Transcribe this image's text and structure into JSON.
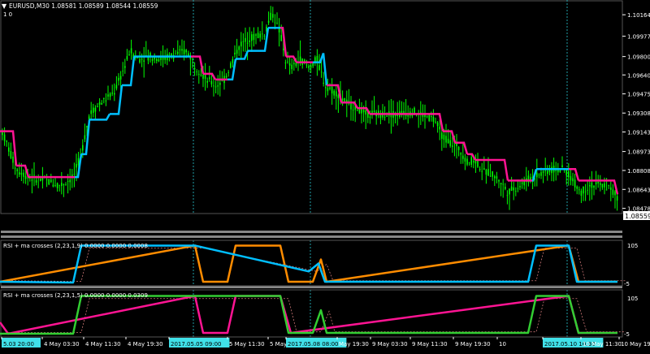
{
  "header": {
    "symbol_title": "EURUSD,M30  1.08581 1.08589 1.08544 1.08559",
    "indicator_label": "1  0"
  },
  "panels": [
    {
      "title": "RSI + ma crosses (2,23,1,9) 0.0000 0.0000 0.0008",
      "scale_top": "105",
      "scale_bottom": "-5"
    },
    {
      "title": "RSI + ma crosses (2,23,1,5) 0.0000 0.0000 0.0309",
      "scale_top": "105",
      "scale_bottom": "-5"
    }
  ],
  "time_axis": [
    {
      "label": "5.03 20:00",
      "highlight": true
    },
    {
      "label": "4 May 03:30",
      "highlight": false
    },
    {
      "label": "4 May 11:30",
      "highlight": false
    },
    {
      "label": "4 May 19:30",
      "highlight": false
    },
    {
      "label": "2017.05.05 09:00",
      "highlight": true
    },
    {
      "label": "5 May 11:30",
      "highlight": false
    },
    {
      "label": "5 May 19:30",
      "highlight": false
    },
    {
      "label": "2017.05.08 08:00",
      "highlight": true
    },
    {
      "label": "May 19:30",
      "highlight": false
    },
    {
      "label": "9 May 03:30",
      "highlight": false
    },
    {
      "label": "9 May 11:30",
      "highlight": false
    },
    {
      "label": "9 May 19:30",
      "highlight": false
    },
    {
      "label": "10",
      "highlight": false
    },
    {
      "label": "2017.05.10 10:30",
      "highlight": true
    },
    {
      "label": "10 May 11:30",
      "highlight": false
    },
    {
      "label": "10 May 19:30",
      "highlight": false
    }
  ],
  "current_price": "1.08559",
  "colors": {
    "background": "#000000",
    "candle": "#00ff00",
    "ma_up": "#00bfff",
    "ma_down": "#ff1493",
    "rsi_fast_up": "#00bfff",
    "rsi_fast_down": "#ff8c00",
    "rsi_green": "#32cd32",
    "rsi_pink": "#ff1493",
    "grid_vline": "#1fa0a8",
    "axis_text": "#ffffff"
  },
  "chart_data": {
    "type": "line",
    "title": "EURUSD,M30",
    "y_ticks": [
      "1.10164",
      "1.09977",
      "1.09800",
      "1.09640",
      "1.09475",
      "1.09308",
      "1.09143",
      "1.08973",
      "1.08808",
      "1.08643",
      "1.08478"
    ],
    "ylim": [
      1.0844,
      1.1025
    ],
    "price_path": [
      [
        0,
        1.092
      ],
      [
        8,
        1.0905
      ],
      [
        20,
        1.0882
      ],
      [
        35,
        1.0875
      ],
      [
        55,
        1.0872
      ],
      [
        75,
        1.0868
      ],
      [
        90,
        1.0875
      ],
      [
        100,
        1.0895
      ],
      [
        110,
        1.093
      ],
      [
        125,
        1.094
      ],
      [
        140,
        1.0948
      ],
      [
        150,
        1.0965
      ],
      [
        160,
        1.0985
      ],
      [
        170,
        1.0978
      ],
      [
        185,
        1.098
      ],
      [
        200,
        1.0978
      ],
      [
        215,
        1.0982
      ],
      [
        230,
        1.0985
      ],
      [
        240,
        1.0972
      ],
      [
        255,
        1.096
      ],
      [
        265,
        1.0955
      ],
      [
        275,
        1.0958
      ],
      [
        285,
        1.0975
      ],
      [
        295,
        1.099
      ],
      [
        305,
        1.0995
      ],
      [
        315,
        1.0998
      ],
      [
        325,
        1.1
      ],
      [
        335,
        1.1018
      ],
      [
        345,
        1.1
      ],
      [
        352,
        1.0975
      ],
      [
        360,
        1.097
      ],
      [
        370,
        1.0978
      ],
      [
        380,
        1.097
      ],
      [
        390,
        1.0978
      ],
      [
        400,
        1.0955
      ],
      [
        410,
        1.095
      ],
      [
        420,
        1.0945
      ],
      [
        430,
        1.0938
      ],
      [
        440,
        1.0935
      ],
      [
        450,
        1.093
      ],
      [
        470,
        1.093
      ],
      [
        490,
        1.093
      ],
      [
        510,
        1.0932
      ],
      [
        525,
        1.0928
      ],
      [
        535,
        1.0925
      ],
      [
        545,
        1.091
      ],
      [
        555,
        1.0905
      ],
      [
        565,
        1.09
      ],
      [
        575,
        1.0888
      ],
      [
        585,
        1.089
      ],
      [
        595,
        1.088
      ],
      [
        605,
        1.0878
      ],
      [
        615,
        1.0872
      ],
      [
        625,
        1.0862
      ],
      [
        640,
        1.0868
      ],
      [
        655,
        1.0875
      ],
      [
        670,
        1.088
      ],
      [
        685,
        1.0882
      ],
      [
        695,
        1.0882
      ],
      [
        705,
        1.0872
      ],
      [
        715,
        1.0862
      ],
      [
        725,
        1.0868
      ],
      [
        740,
        1.0868
      ],
      [
        752,
        1.0865
      ],
      [
        760,
        1.0856
      ]
    ],
    "ma_step": [
      [
        0,
        1.0915,
        "d"
      ],
      [
        20,
        1.0885,
        "d"
      ],
      [
        35,
        1.0875,
        "d"
      ],
      [
        92,
        1.0875,
        "u"
      ],
      [
        100,
        1.0895,
        "u"
      ],
      [
        110,
        1.0925,
        "u"
      ],
      [
        135,
        1.093,
        "u"
      ],
      [
        150,
        1.0955,
        "u"
      ],
      [
        165,
        1.098,
        "u"
      ],
      [
        235,
        1.098,
        "d"
      ],
      [
        250,
        1.0965,
        "d"
      ],
      [
        265,
        1.096,
        "d"
      ],
      [
        280,
        1.096,
        "u"
      ],
      [
        290,
        1.0978,
        "u"
      ],
      [
        305,
        1.0985,
        "u"
      ],
      [
        330,
        1.1005,
        "u"
      ],
      [
        345,
        1.1005,
        "d"
      ],
      [
        352,
        1.098,
        "d"
      ],
      [
        365,
        1.0975,
        "d"
      ],
      [
        385,
        1.0975,
        "u"
      ],
      [
        398,
        1.0983,
        "u"
      ],
      [
        402,
        1.0955,
        "d"
      ],
      [
        420,
        1.094,
        "d"
      ],
      [
        440,
        1.0935,
        "d"
      ],
      [
        455,
        1.093,
        "d"
      ],
      [
        535,
        1.093,
        "d"
      ],
      [
        545,
        1.0915,
        "d"
      ],
      [
        560,
        1.0905,
        "d"
      ],
      [
        575,
        1.0895,
        "d"
      ],
      [
        585,
        1.089,
        "d"
      ],
      [
        620,
        1.089,
        "d"
      ],
      [
        625,
        1.0872,
        "d"
      ],
      [
        655,
        1.0872,
        "u"
      ],
      [
        660,
        1.0882,
        "u"
      ],
      [
        700,
        1.0882,
        "d"
      ],
      [
        712,
        1.0872,
        "d"
      ],
      [
        740,
        1.0872,
        "d"
      ],
      [
        760,
        1.086,
        "d"
      ]
    ],
    "rsi1_up": [
      [
        0,
        4
      ],
      [
        90,
        2
      ],
      [
        100,
        95
      ],
      [
        240,
        95
      ],
      [
        380,
        30
      ],
      [
        392,
        50
      ],
      [
        400,
        4
      ],
      [
        650,
        4
      ],
      [
        660,
        95
      ],
      [
        700,
        95
      ],
      [
        710,
        4
      ],
      [
        760,
        4
      ]
    ],
    "rsi1_down": [
      [
        0,
        4
      ],
      [
        240,
        95
      ],
      [
        250,
        4
      ],
      [
        280,
        4
      ],
      [
        290,
        95
      ],
      [
        345,
        95
      ],
      [
        355,
        4
      ],
      [
        385,
        4
      ],
      [
        395,
        60
      ],
      [
        402,
        4
      ],
      [
        700,
        95
      ],
      [
        712,
        4
      ],
      [
        760,
        4
      ]
    ],
    "rsi2_up": [
      [
        0,
        2
      ],
      [
        90,
        2
      ],
      [
        100,
        95
      ],
      [
        240,
        95
      ],
      [
        345,
        95
      ],
      [
        355,
        4
      ],
      [
        385,
        4
      ],
      [
        395,
        60
      ],
      [
        402,
        4
      ],
      [
        650,
        4
      ],
      [
        660,
        95
      ],
      [
        700,
        95
      ],
      [
        712,
        4
      ],
      [
        760,
        4
      ]
    ],
    "rsi2_down": [
      [
        0,
        30
      ],
      [
        10,
        2
      ],
      [
        240,
        95
      ],
      [
        250,
        4
      ],
      [
        280,
        4
      ],
      [
        290,
        95
      ],
      [
        345,
        95
      ],
      [
        358,
        4
      ],
      [
        700,
        95
      ],
      [
        712,
        4
      ],
      [
        760,
        4
      ]
    ]
  }
}
